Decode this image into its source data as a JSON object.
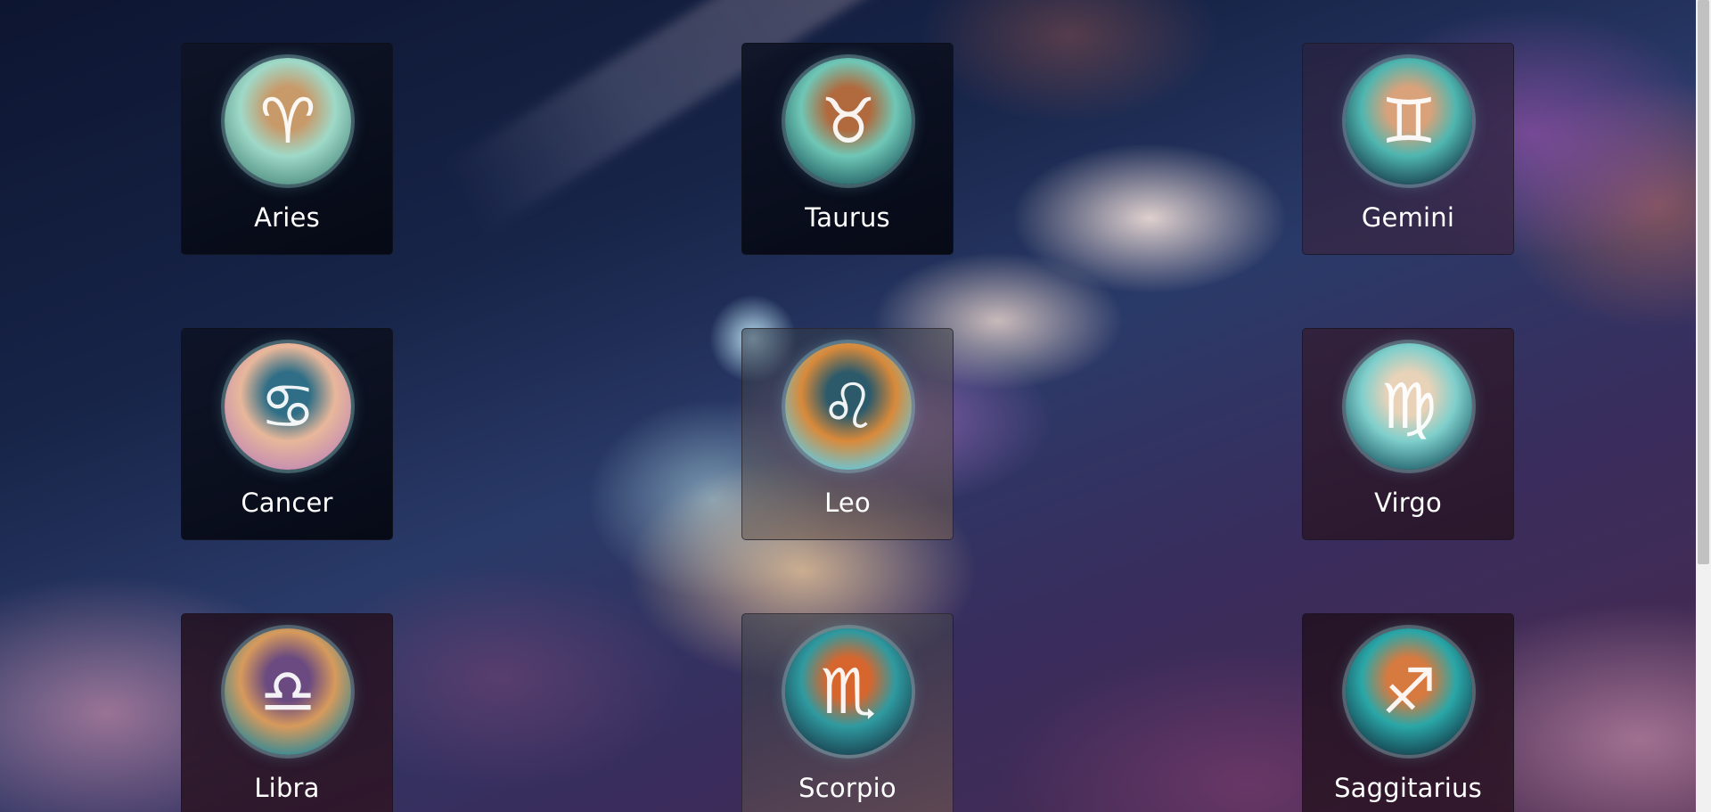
{
  "signs": [
    {
      "name": "Aries",
      "icon": "aries-emblem-icon",
      "glyph": "♈",
      "style": "dark",
      "emblem_colors": [
        "#9fd9c8",
        "#c89a6a",
        "#5c9a8c"
      ]
    },
    {
      "name": "Taurus",
      "icon": "taurus-emblem-icon",
      "glyph": "♉",
      "style": "dark",
      "emblem_colors": [
        "#6fc7b6",
        "#b06a3e",
        "#2e6f70"
      ]
    },
    {
      "name": "Gemini",
      "icon": "gemini-emblem-icon",
      "glyph": "♊",
      "style": "dusk",
      "emblem_colors": [
        "#4fb6b0",
        "#d9a27a",
        "#1f4e5a"
      ]
    },
    {
      "name": "Cancer",
      "icon": "cancer-emblem-icon",
      "glyph": "♋",
      "style": "dark",
      "emblem_colors": [
        "#e8b79a",
        "#2f6e86",
        "#c78fb0"
      ]
    },
    {
      "name": "Leo",
      "icon": "leo-emblem-icon",
      "glyph": "♌",
      "style": "glass",
      "emblem_colors": [
        "#d98a3a",
        "#2d5a6a",
        "#6fc3cf"
      ]
    },
    {
      "name": "Virgo",
      "icon": "virgo-emblem-icon",
      "glyph": "♍",
      "style": "plum",
      "emblem_colors": [
        "#7fcfcc",
        "#e8d2b8",
        "#2d6f78"
      ]
    },
    {
      "name": "Libra",
      "icon": "libra-emblem-icon",
      "glyph": "♎",
      "style": "wine",
      "emblem_colors": [
        "#d79a5c",
        "#6a4a80",
        "#3e8a92"
      ]
    },
    {
      "name": "Scorpio",
      "icon": "scorpio-emblem-icon",
      "glyph": "♏",
      "style": "glass",
      "emblem_colors": [
        "#2f9aa0",
        "#d7662e",
        "#1c4a58"
      ]
    },
    {
      "name": "Saggitarius",
      "icon": "sagittarius-emblem-icon",
      "glyph": "♐",
      "style": "wine",
      "emblem_colors": [
        "#2aa7a8",
        "#d67a40",
        "#174a56"
      ]
    }
  ]
}
